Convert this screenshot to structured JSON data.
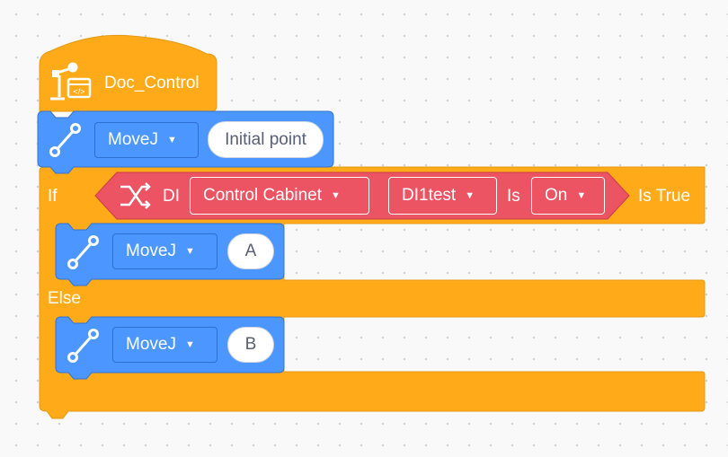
{
  "hat_block": {
    "label": "Doc_Control",
    "icon": "robot-arm-doc-icon"
  },
  "move_blocks": [
    {
      "command": "MoveJ",
      "point": "Initial point"
    },
    {
      "command": "MoveJ",
      "point": "A"
    },
    {
      "command": "MoveJ",
      "point": "B"
    }
  ],
  "if_block": {
    "if_label": "If",
    "else_label": "Else",
    "is_true_label": "Is True",
    "condition": {
      "icon": "shuffle-icon",
      "di_label": "DI",
      "source": "Control Cabinet",
      "port": "DI1test",
      "is_label": "Is",
      "state": "On"
    }
  },
  "colors": {
    "control": "#ffab19",
    "motion": "#4c97ff",
    "condition": "#ec5363",
    "background": "#f9f9f9"
  }
}
